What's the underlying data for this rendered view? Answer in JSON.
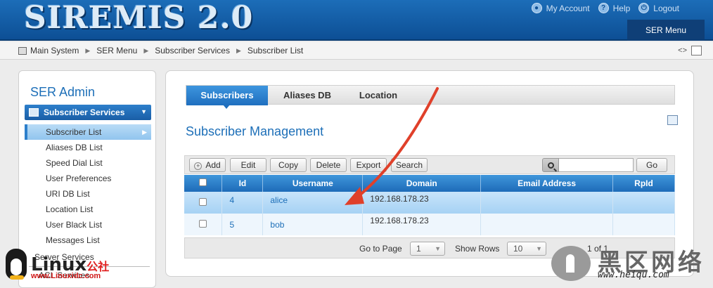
{
  "header": {
    "logo": "SIREMIS 2.0",
    "links": [
      {
        "label": "My Account",
        "icon": "user-icon"
      },
      {
        "label": "Help",
        "icon": "help-icon"
      },
      {
        "label": "Logout",
        "icon": "power-icon"
      }
    ],
    "menu_tab": "SER Menu"
  },
  "breadcrumb": {
    "items": [
      "Main System",
      "SER Menu",
      "Subscriber Services",
      "Subscriber List"
    ],
    "code_glyph": "<>"
  },
  "sidebar": {
    "title": "SER Admin",
    "group": "Subscriber Services",
    "items": [
      "Subscriber List",
      "Aliases DB List",
      "Speed Dial List",
      "User Preferences",
      "URI DB List",
      "Location List",
      "User Black List",
      "Messages List"
    ],
    "active_item": "Subscriber List",
    "group2": "Server Services",
    "group3": "ACL Services"
  },
  "main": {
    "tabs": [
      "Subscribers",
      "Aliases DB",
      "Location"
    ],
    "active_tab": "Subscribers",
    "title": "Subscriber Management",
    "toolbar": {
      "buttons": [
        "Add",
        "Edit",
        "Copy",
        "Delete",
        "Export",
        "Search"
      ],
      "search_value": "",
      "go_label": "Go"
    },
    "table": {
      "columns": [
        "Id",
        "Username",
        "Domain",
        "Email Address",
        "RpId"
      ],
      "rows": [
        {
          "id": "4",
          "username": "alice",
          "domain": "192.168.178.23",
          "email": "",
          "rpid": ""
        },
        {
          "id": "5",
          "username": "bob",
          "domain": "192.168.178.23",
          "email": "",
          "rpid": ""
        }
      ]
    },
    "pager": {
      "goto_label": "Go to Page",
      "page": "1",
      "show_rows_label": "Show Rows",
      "rows": "10",
      "of_label": "1 of 1"
    }
  },
  "watermarks": {
    "left_text": "Linux",
    "left_cn": "公社",
    "left_url": "www.Linuxidc.com",
    "right_cn": "黑区网络",
    "right_url": "www.heiqu.com"
  },
  "colors": {
    "header_blue": "#1c6db8",
    "accent_blue": "#1d6fb8",
    "arrow_red": "#e0402a"
  }
}
